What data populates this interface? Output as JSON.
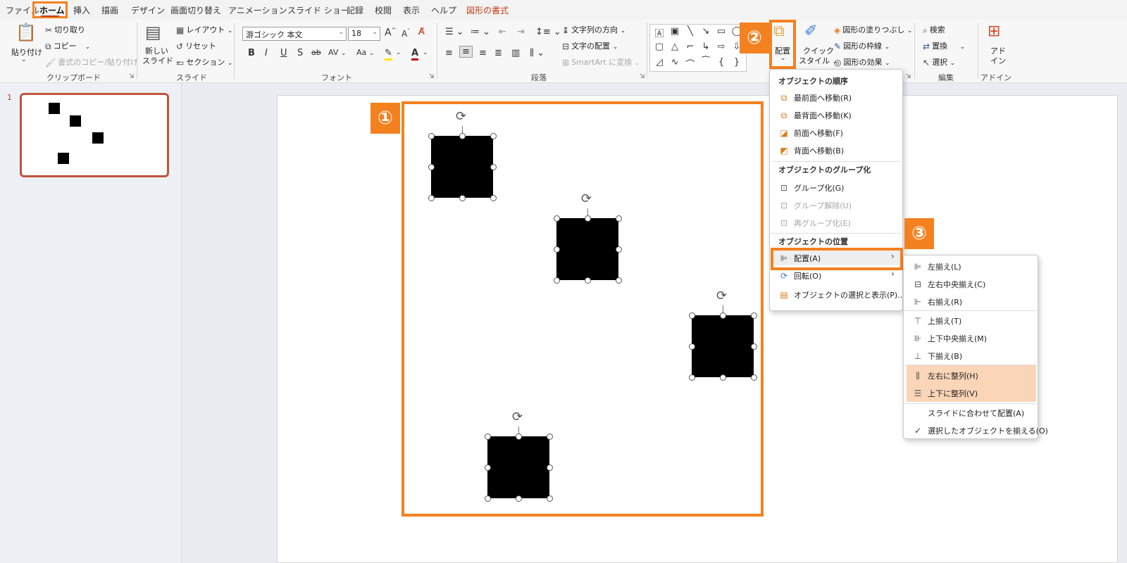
{
  "tabs": [
    "ファイル",
    "ホーム",
    "挿入",
    "描画",
    "デザイン",
    "画面切り替え",
    "アニメーション",
    "スライド ショー",
    "記録",
    "校閲",
    "表示",
    "ヘルプ",
    "図形の書式"
  ],
  "ribbon": {
    "clipboard": {
      "label": "クリップボード",
      "paste": "貼り付け",
      "cut": "切り取り",
      "copy": "コピー",
      "format_painter": "書式のコピー/貼り付け"
    },
    "slides": {
      "label": "スライド",
      "new_slide_1": "新しい",
      "new_slide_2": "スライド",
      "layout": "レイアウト",
      "reset": "リセット",
      "section": "セクション"
    },
    "font": {
      "label": "フォント",
      "font_name": "游ゴシック 本文",
      "font_size": "18",
      "bold": "B",
      "italic": "I",
      "underline": "U",
      "shadow": "S",
      "strike": "ab",
      "spacing": "AV",
      "case": "Aa",
      "grow": "A",
      "shrink": "A"
    },
    "paragraph": {
      "label": "段落",
      "text_direction": "文字列の方向",
      "align_text": "文字の配置",
      "smartart": "SmartArt に変換"
    },
    "drawing": {
      "arrange": "配置",
      "quick_styles_1": "クイック",
      "quick_styles_2": "スタイル",
      "fill": "図形の塗りつぶし",
      "outline": "図形の枠線",
      "effects": "図形の効果"
    },
    "editing": {
      "label": "編集",
      "find": "検索",
      "replace": "置換",
      "select": "選択"
    },
    "addins": {
      "label": "アドイン",
      "addin_1": "アド",
      "addin_2": "イン"
    }
  },
  "thumbnail": {
    "number": "1"
  },
  "callouts": {
    "one": "①",
    "two": "②",
    "three": "③"
  },
  "arrange_menu": {
    "order_header": "オブジェクトの順序",
    "bring_to_front": "最前面へ移動(R)",
    "send_to_back": "最背面へ移動(K)",
    "bring_forward": "前面へ移動(F)",
    "send_backward": "背面へ移動(B)",
    "group_header": "オブジェクトのグループ化",
    "group": "グループ化(G)",
    "ungroup": "グループ解除(U)",
    "regroup": "再グループ化(E)",
    "position_header": "オブジェクトの位置",
    "align": "配置(A)",
    "rotate": "回転(O)",
    "selection_pane": "オブジェクトの選択と表示(P)..."
  },
  "align_menu": {
    "left": "左揃え(L)",
    "center": "左右中央揃え(C)",
    "right": "右揃え(R)",
    "top": "上揃え(T)",
    "middle": "上下中央揃え(M)",
    "bottom": "下揃え(B)",
    "distribute_h": "左右に整列(H)",
    "distribute_v": "上下に整列(V)",
    "align_to_slide": "スライドに合わせて配置(A)",
    "align_selected": "選択したオブジェクトを揃える(O)"
  },
  "colors": {
    "accent": "#f48120",
    "highlight": "#fbd5b7",
    "brand": "#c43e1c"
  }
}
